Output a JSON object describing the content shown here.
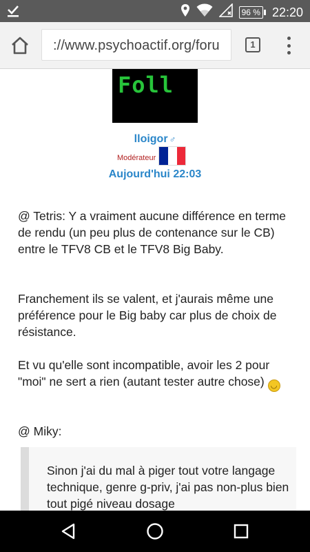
{
  "status_bar": {
    "left_icon": "download-done-icon",
    "icons": [
      "location-icon",
      "wifi-icon",
      "no-sim-icon"
    ],
    "battery_percent": "96 %",
    "time": "22:20"
  },
  "browser": {
    "url": "://www.psychoactif.org/foru",
    "tab_count": "1",
    "home_icon": "home-icon",
    "menu_icon": "overflow-menu-icon"
  },
  "post": {
    "avatar_text": "Foll",
    "username": "lloigor",
    "gender_symbol": "♂",
    "role": "Modérateur",
    "flag_colors": [
      "#002395",
      "#ffffff",
      "#ed2939"
    ],
    "date": "Aujourd'hui 22:03",
    "paragraphs": [
      "@ Tetris: Y a vraiment aucune différence en terme de rendu (un peu plus de contenance sur le CB) entre le TFV8 CB et le TFV8 Big Baby.",
      "Franchement ils se valent, et j'aurais même une préférence pour le Big baby car plus de choix de résistance.",
      "Et vu qu'elle sont incompatible, avoir les 2 pour \"moi\" ne sert a rien (autant tester autre chose)",
      "@ Miky:"
    ],
    "emoji": "smiley-icon",
    "quote": "Sinon j'ai du mal à piger tout votre langage technique, genre g-priv, j'ai pas non-plus bien tout pigé niveau dosage"
  },
  "colors": {
    "link_blue": "#2a86c9",
    "moderator_red": "#b22222",
    "avatar_green": "#27c43a"
  },
  "nav_bar": {
    "buttons": [
      "back-icon",
      "home-icon",
      "recents-icon"
    ]
  }
}
